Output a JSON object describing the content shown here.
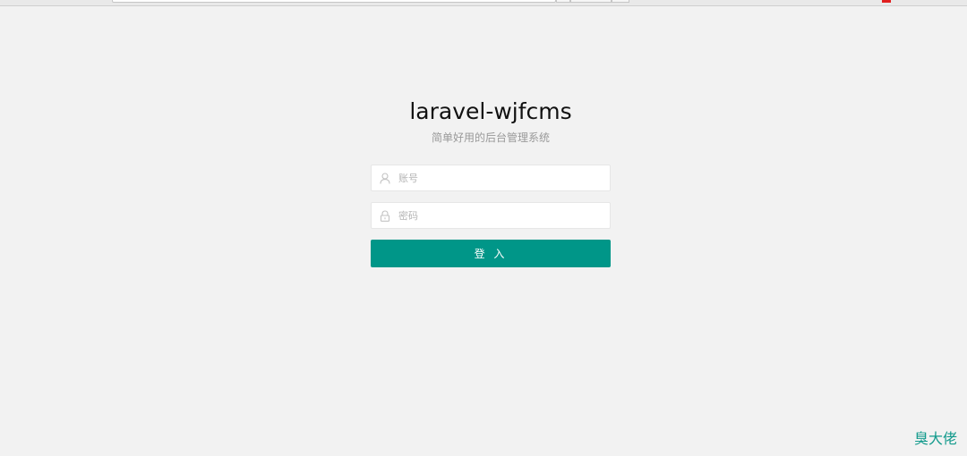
{
  "login": {
    "title": "laravel-wjfcms",
    "subtitle": "简单好用的后台管理系统",
    "username": {
      "placeholder": "账号",
      "value": "",
      "icon": "user-icon"
    },
    "password": {
      "placeholder": "密码",
      "value": "",
      "icon": "lock-icon"
    },
    "submit_label": "登 入"
  },
  "watermark": "臭大佬",
  "colors": {
    "background": "#f2f2f2",
    "primary": "#009688",
    "watermark": "#129a8c"
  }
}
